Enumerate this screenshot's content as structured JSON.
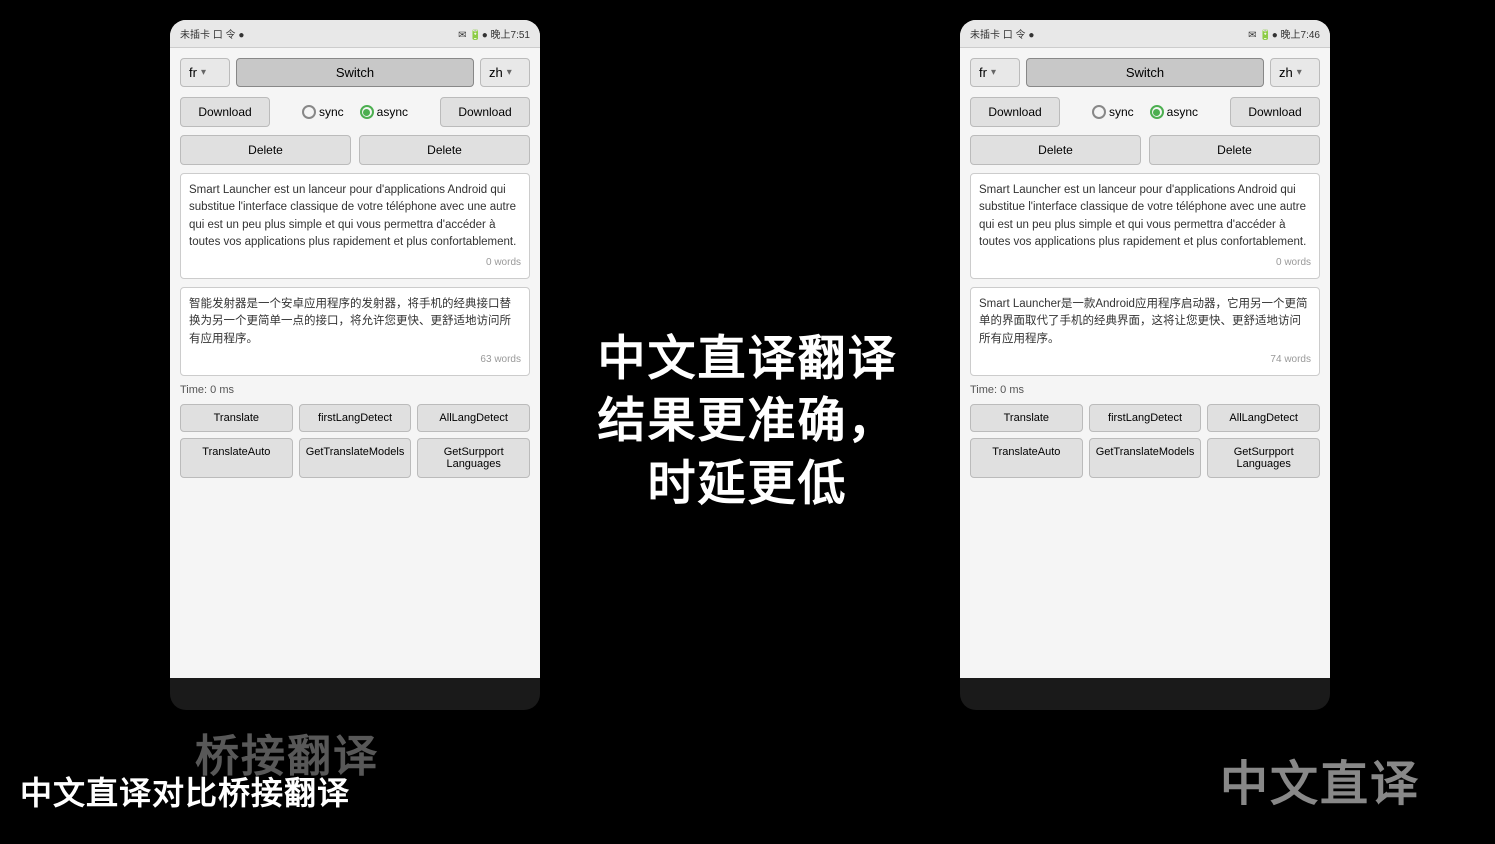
{
  "background": "#000000",
  "center_overlay": {
    "lines": [
      "中文直译翻译",
      "结果更准确，",
      "时延更低"
    ]
  },
  "bottom_label_left": "中文直译对比桥接翻译",
  "bottom_label_bridge": "桥接翻译",
  "bottom_label_right": "中文直译",
  "phone_left": {
    "status_bar": {
      "left": "未插卡 口 令 ●",
      "right": "✉ 🔋● 晚上7:51"
    },
    "lang_from": "fr",
    "switch_label": "Switch",
    "lang_to": "zh",
    "radio_sync": "sync",
    "radio_async": "async",
    "download_left": "Download",
    "download_right": "Download",
    "delete_left": "Delete",
    "delete_right": "Delete",
    "source_text": "Smart Launcher est un lanceur pour d'applications Android qui substitue l'interface classique de votre téléphone avec une autre qui est un peu plus simple et qui vous permettra d'accéder à toutes vos applications plus rapidement et plus confortablement.",
    "source_words": "0 words",
    "translated_text": "智能发射器是一个安卓应用程序的发射器，将手机的经典接口替换为另一个更简单一点的接口，将允许您更快、更舒适地访问所有应用程序。",
    "translated_words": "63 words",
    "time_label": "Time:  0 ms",
    "buttons_row1": [
      "Translate",
      "firstLangDetect",
      "AllLangDetect"
    ],
    "buttons_row2": [
      "TranslateAuto",
      "GetTranslateModels",
      "GetSurpport Languages"
    ]
  },
  "phone_right": {
    "status_bar": {
      "left": "未插卡 口 令 ●",
      "right": "✉ 🔋● 晚上7:46"
    },
    "lang_from": "fr",
    "switch_label": "Switch",
    "lang_to": "zh",
    "radio_sync": "sync",
    "radio_async": "async",
    "download_left": "Download",
    "download_right": "Download",
    "delete_left": "Delete",
    "delete_right": "Delete",
    "source_text": "Smart Launcher est un lanceur pour d'applications Android qui substitue l'interface classique de votre téléphone avec une autre qui est un peu plus simple et qui vous permettra d'accéder à toutes vos applications plus rapidement et plus confortablement.",
    "source_words": "0 words",
    "translated_text": "Smart Launcher是一款Android应用程序启动器，它用另一个更简单的界面取代了手机的经典界面，这将让您更快、更舒适地访问所有应用程序。",
    "translated_words": "74 words",
    "time_label": "Time:  0 ms",
    "buttons_row1": [
      "Translate",
      "firstLangDetect",
      "AllLangDetect"
    ],
    "buttons_row2": [
      "TranslateAuto",
      "GetTranslateModels",
      "GetSurpport Languages"
    ]
  }
}
